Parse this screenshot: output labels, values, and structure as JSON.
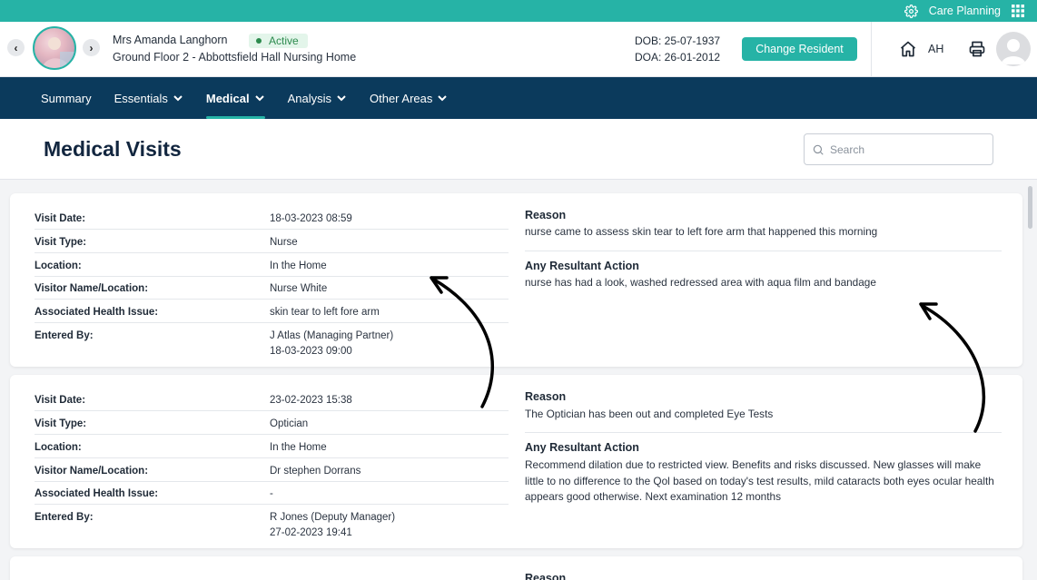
{
  "topbar": {
    "title": "Care Planning",
    "settings_icon": "gear-icon",
    "apps_icon": "grid-icon"
  },
  "resident": {
    "name": "Mrs Amanda Langhorn",
    "status": "Active",
    "location": "Ground Floor 2 - Abbottsfield Hall Nursing Home",
    "dob": "DOB: 25-07-1937",
    "doa": "DOA: 26-01-2012",
    "change_label": "Change Resident"
  },
  "header": {
    "initials": "AH"
  },
  "nav": {
    "items": [
      {
        "label": "Summary"
      },
      {
        "label": "Essentials"
      },
      {
        "label": "Medical"
      },
      {
        "label": "Analysis"
      },
      {
        "label": "Other Areas"
      }
    ]
  },
  "page": {
    "title": "Medical Visits",
    "search_placeholder": "Search"
  },
  "labels": {
    "visit_date": "Visit Date:",
    "visit_type": "Visit Type:",
    "location": "Location:",
    "visitor": "Visitor Name/Location:",
    "health_issue": "Associated Health Issue:",
    "entered_by": "Entered By:",
    "reason": "Reason",
    "action": "Any Resultant Action"
  },
  "visits": [
    {
      "visit_date": "18-03-2023 08:59",
      "visit_type": "Nurse",
      "location": "In the Home",
      "visitor": "Nurse White",
      "health_issue": "skin tear to left fore arm",
      "entered_by": "J Atlas (Managing Partner)",
      "entered_at": "18-03-2023 09:00",
      "reason": "nurse came to assess skin tear to left fore arm that happened this morning",
      "action": "nurse has had a look, washed redressed area with aqua film and bandage"
    },
    {
      "visit_date": "23-02-2023 15:38",
      "visit_type": "Optician",
      "location": "In the Home",
      "visitor": "Dr stephen Dorrans",
      "health_issue": "-",
      "entered_by": "R Jones (Deputy Manager)",
      "entered_at": "27-02-2023 19:41",
      "reason": "The Optician has been out and completed Eye Tests",
      "action": "Recommend dilation due to restricted view. Benefits and risks discussed. New glasses will make little to no difference to the Qol based on today's test results, mild cataracts both eyes ocular health appears good otherwise. Next examination 12 months"
    }
  ],
  "partial_card": {
    "reason": "Reason"
  }
}
